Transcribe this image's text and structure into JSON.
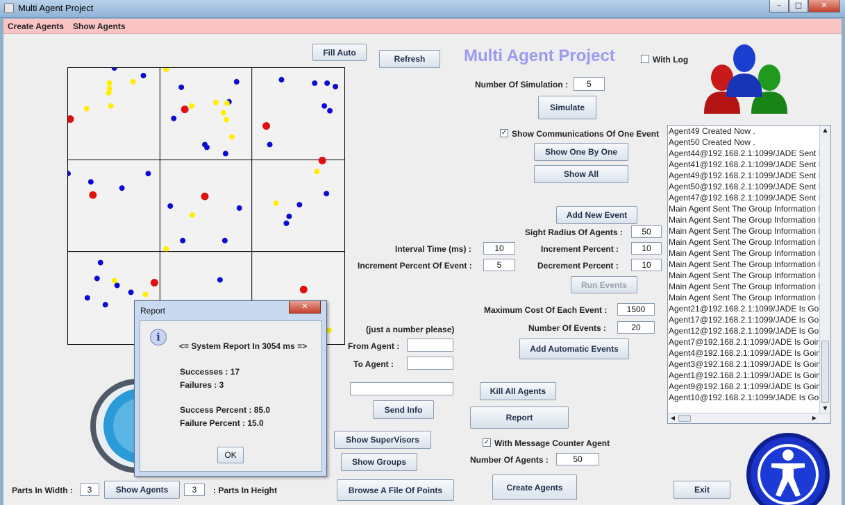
{
  "window": {
    "title": "Multi Agent Project",
    "min": "‒",
    "max": "□",
    "close": "✕"
  },
  "menu": {
    "create_agents": "Create Agents",
    "show_agents": "Show Agents"
  },
  "header": {
    "title": "Multi Agent Project",
    "with_log": "With Log"
  },
  "buttons": {
    "fill_auto": "Fill Auto",
    "refresh": "Refresh",
    "simulate": "Simulate",
    "show_one_by_one": "Show One By One",
    "show_all": "Show All",
    "add_new_event": "Add New Event",
    "run_events": "Run Events",
    "add_automatic_events": "Add Automatic Events",
    "kill_all_agents": "Kill All Agents",
    "report": "Report",
    "send_info": "Send Info",
    "show_supervisors": "Show SuperVisors",
    "show_groups": "Show Groups",
    "browse_file": "Browse A File Of Points",
    "create_agents": "Create Agents",
    "exit": "Exit",
    "show_agents": "Show Agents"
  },
  "simulation": {
    "label": "Number Of Simulation :",
    "value": "5"
  },
  "show_comm": {
    "label": "Show Communications Of One Event",
    "checked": true
  },
  "params": {
    "sight_radius_label": "Sight Radius Of Agents :",
    "sight_radius": "50",
    "interval_label": "Interval Time (ms) :",
    "interval": "10",
    "increment_percent_label": "Increment Percent :",
    "increment_percent": "10",
    "increment_event_label": "Increment Percent Of Event :",
    "increment_event": "5",
    "decrement_percent_label": "Decrement Percent :",
    "decrement_percent": "10",
    "max_cost_label": "Maximum Cost Of Each Event :",
    "max_cost": "1500",
    "num_events_label": "Number Of Events :",
    "num_events": "20"
  },
  "send": {
    "hint": "(just a number please)",
    "from_label": "From Agent :",
    "to_label": "To Agent :",
    "from_value": "",
    "to_value": "",
    "info_value": ""
  },
  "message_counter": {
    "label": "With Message Counter Agent",
    "checked": true
  },
  "num_agents": {
    "label": "Number Of Agents :",
    "value": "50"
  },
  "bottom": {
    "parts_width_label": "Parts In Width :",
    "parts_width": "3",
    "parts_height": "3",
    "parts_height_label": ": Parts In Height"
  },
  "log": [
    "Agent49 Created Now .",
    "Agent50 Created Now .",
    "Agent44@192.168.2.1:1099/JADE Sent I",
    "Agent41@192.168.2.1:1099/JADE Sent I",
    "Agent49@192.168.2.1:1099/JADE Sent I",
    "Agent50@192.168.2.1:1099/JADE Sent I",
    "Agent47@192.168.2.1:1099/JADE Sent I",
    "Main Agent Sent The Group Information I",
    "Main Agent Sent The Group Information I",
    "Main Agent Sent The Group Information I",
    "Main Agent Sent The Group Information I",
    "Main Agent Sent The Group Information I",
    "Main Agent Sent The Group Information I",
    "Main Agent Sent The Group Information I",
    "Main Agent Sent The Group Information I",
    "Main Agent Sent The Group Information I",
    "Agent21@192.168.2.1:1099/JADE Is Goi",
    "Agent17@192.168.2.1:1099/JADE Is Goi",
    "Agent12@192.168.2.1:1099/JADE Is Goi",
    "Agent7@192.168.2.1:1099/JADE Is Goin",
    "Agent4@192.168.2.1:1099/JADE Is Goin",
    "Agent3@192.168.2.1:1099/JADE Is Goin",
    "Agent1@192.168.2.1:1099/JADE Is Goin",
    "Agent9@192.168.2.1:1099/JADE Is Goin",
    "Agent10@192.168.2.1:1099/JADE Is Go"
  ],
  "report": {
    "title": "Report",
    "header": "<= System Report In 3054 ms =>",
    "successes": "Successes :  17",
    "failures": "Failures :  3",
    "success_percent": "Success Percent :  85.0",
    "failure_percent": "Failure Percent :  15.0",
    "ok": "OK"
  },
  "colors": {
    "blue_agent": "#0a0ad2",
    "yellow_agent": "#ffee00",
    "red_agent": "#e01010",
    "menu_bg": "#fbc4c4",
    "title_accent": "#9a9af0"
  }
}
